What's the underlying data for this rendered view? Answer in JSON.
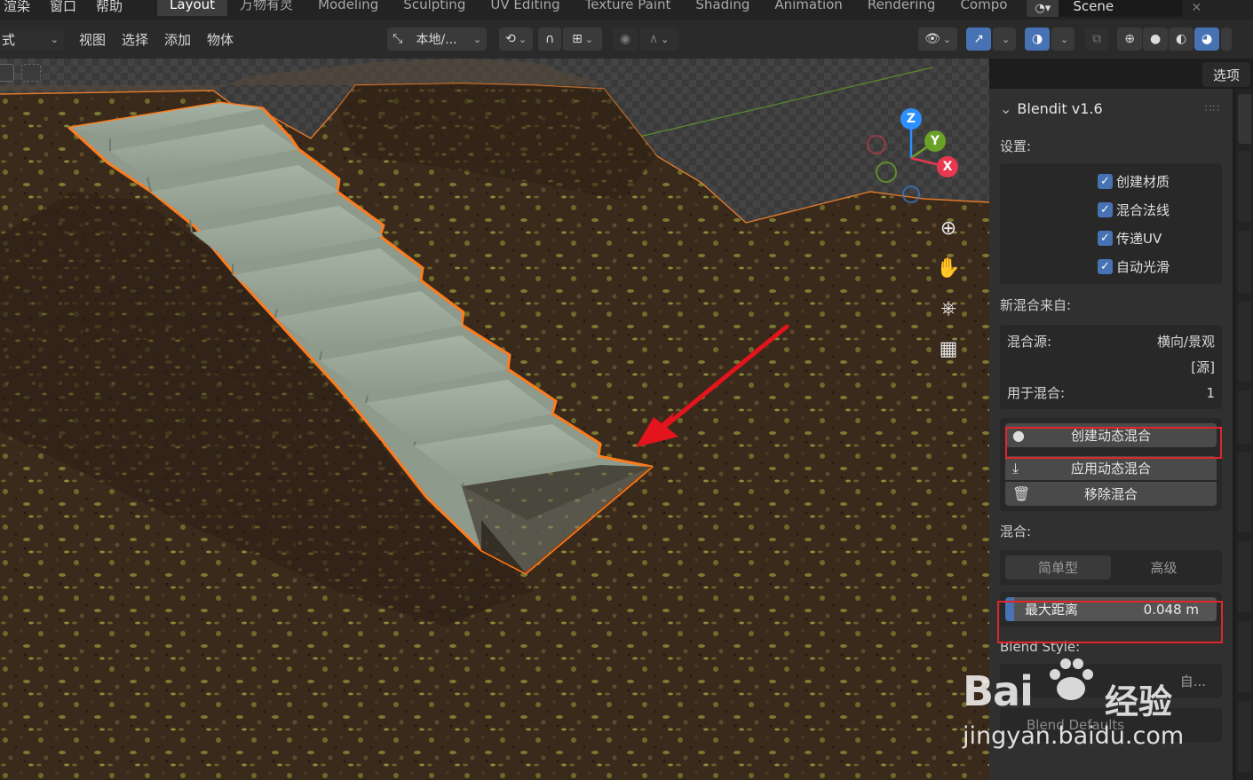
{
  "topbar": {
    "menus": [
      "渲染",
      "窗口",
      "帮助"
    ],
    "workspaces": [
      {
        "label": "Layout",
        "active": true
      },
      {
        "label": "万物有灵",
        "active": false
      },
      {
        "label": "Modeling",
        "active": false
      },
      {
        "label": "Sculpting",
        "active": false
      },
      {
        "label": "UV Editing",
        "active": false
      },
      {
        "label": "Texture Paint",
        "active": false
      },
      {
        "label": "Shading",
        "active": false
      },
      {
        "label": "Animation",
        "active": false
      },
      {
        "label": "Rendering",
        "active": false
      },
      {
        "label": "Compo",
        "active": false
      }
    ],
    "scene_name": "Scene"
  },
  "header": {
    "mode_label": "式",
    "menus": [
      "视图",
      "选择",
      "添加",
      "物体"
    ],
    "transform_orientation": "本地/..."
  },
  "viewport": {
    "gizmo_axes": [
      "Z",
      "Y",
      "X"
    ],
    "options_tab": "选项"
  },
  "npanel": {
    "title": "Blendit v1.6",
    "settings_label": "设置:",
    "checkboxes": [
      {
        "label": "创建材质",
        "checked": true
      },
      {
        "label": "混合法线",
        "checked": true
      },
      {
        "label": "传递UV",
        "checked": true
      },
      {
        "label": "自动光滑",
        "checked": true
      }
    ],
    "new_blend_label": "新混合来自:",
    "blend_source_key": "混合源:",
    "blend_source_value": "横向/景观",
    "blend_source_value2": "[源]",
    "used_for_blend_key": "用于混合:",
    "used_for_blend_value": "1",
    "buttons": {
      "create_dynamic": "创建动态混合",
      "apply_dynamic": "应用动态混合",
      "remove_blend": "移除混合"
    },
    "blend_label": "混合:",
    "blend_modes": [
      "简单型",
      "高级"
    ],
    "max_distance_label": "最大距离",
    "max_distance_value": "0.048 m",
    "blend_style_label": "Blend Style:",
    "blend_style_option": "自...",
    "blend_defaults_label": "Blend Defaults"
  },
  "watermark": {
    "brand": "Bai",
    "brand_cn": "经验",
    "url": "jingyan.baidu.com"
  },
  "colors": {
    "accent_blue": "#4772b3",
    "selection_orange": "#ff7b1c",
    "highlight_red": "#e0262d",
    "axis_x": "#e8384f",
    "axis_y": "#6aa127",
    "axis_z": "#2c8fff"
  }
}
